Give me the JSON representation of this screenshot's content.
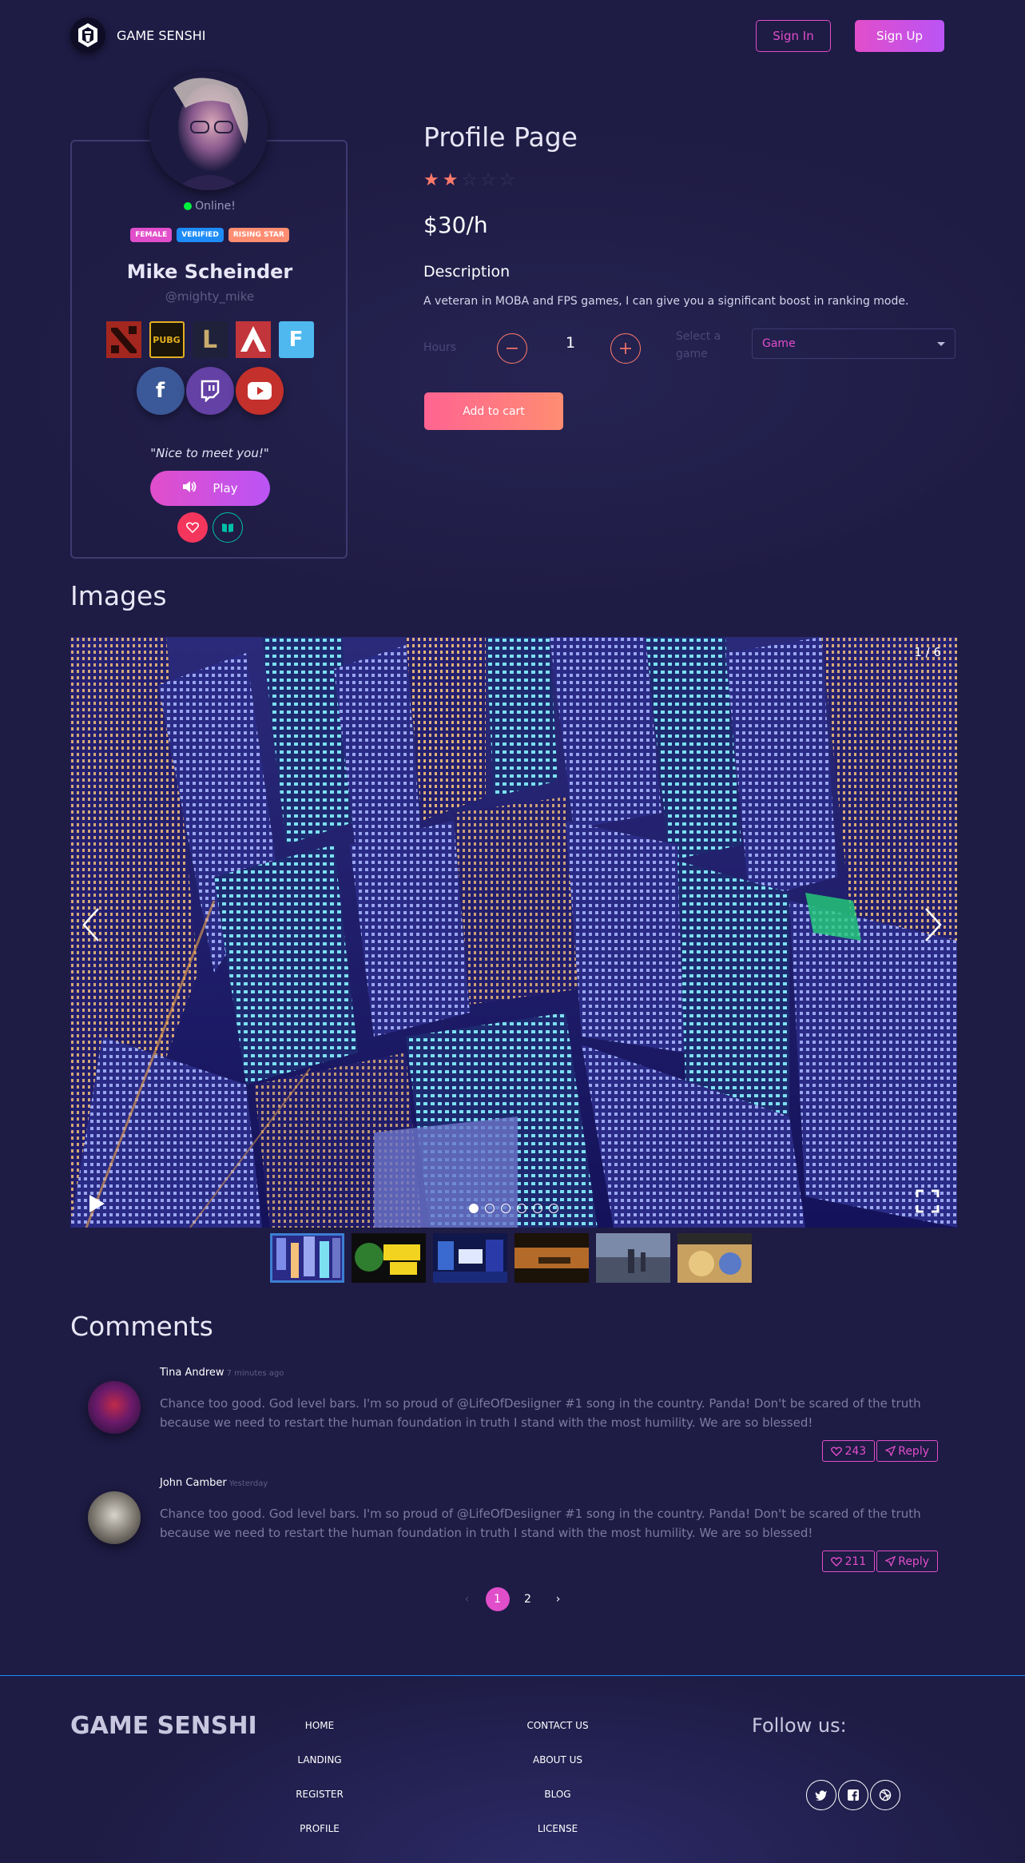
{
  "navbar": {
    "brand": "GAME SENSHI",
    "sign_in": "Sign In",
    "sign_up": "Sign Up"
  },
  "profile": {
    "status": "Online!",
    "badges": [
      "FEMALE",
      "VERIFIED",
      "RISING STAR"
    ],
    "name": "Mike Scheinder",
    "username": "@mighty_mike",
    "games": [
      "dota2-icon",
      "pubg-icon",
      "league-of-legends-icon",
      "apex-legends-icon",
      "fortnite-icon"
    ],
    "game_labels": {
      "pubg": "PUBG",
      "lol": "L",
      "fortnite": "F"
    },
    "social": {
      "facebook": "f",
      "twitch": "twitch",
      "youtube": "youtube"
    },
    "quote": "\"Nice to meet you!\"",
    "play_label": "Play"
  },
  "product": {
    "title": "Profile Page",
    "rating": 2,
    "rating_max": 5,
    "price": "$30/h",
    "description_heading": "Description",
    "description": "A veteran in MOBA and FPS games, I can give you a significant boost in ranking mode.",
    "hours_label": "Hours",
    "quantity": "1",
    "select_label": "Select a game",
    "select_value": "Game",
    "add_to_cart": "Add to cart"
  },
  "images": {
    "heading": "Images",
    "counter": "1 / 6",
    "total": 6,
    "current": 1
  },
  "comments": {
    "heading": "Comments",
    "items": [
      {
        "name": "Tina Andrew",
        "time": "7 minutes ago",
        "text": "Chance too good. God level bars. I'm so proud of @LifeOfDesiigner #1 song in the country. Panda! Don't be scared of the truth because we need to restart the human foundation in truth I stand with the most humility. We are so blessed!",
        "likes": "243",
        "reply": "Reply"
      },
      {
        "name": "John Camber",
        "time": "Yesterday",
        "text": "Chance too good. God level bars. I'm so proud of @LifeOfDesiigner #1 song in the country. Panda! Don't be scared of the truth because we need to restart the human foundation in truth I stand with the most humility. We are so blessed!",
        "likes": "211",
        "reply": "Reply"
      }
    ],
    "pagination": {
      "prev": "‹",
      "pages": [
        "1",
        "2"
      ],
      "next": "›",
      "current": "1"
    }
  },
  "footer": {
    "brand": "GAME SENSHI",
    "col1": [
      "HOME",
      "LANDING",
      "REGISTER",
      "PROFILE"
    ],
    "col2": [
      "CONTACT US",
      "ABOUT US",
      "BLOG",
      "LICENSE"
    ],
    "follow": "Follow us:",
    "socials": [
      "twitter-icon",
      "facebook-square-icon",
      "dribbble-icon"
    ]
  },
  "colors": {
    "background": "#1e1b44",
    "primary": "#e14eca",
    "accent": "#ff8d72",
    "info": "#1d8cf8",
    "online": "#00f23d"
  }
}
